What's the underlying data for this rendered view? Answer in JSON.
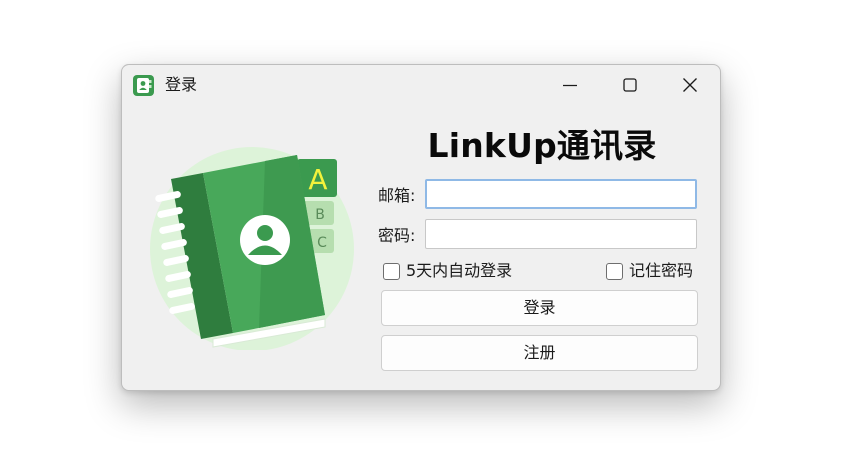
{
  "window": {
    "title": "登录",
    "icon": "app-contacts-icon",
    "controls": [
      "minimize-icon",
      "maximize-icon",
      "close-icon"
    ]
  },
  "illustration": {
    "icon": "address-book-icon",
    "tab_letters": [
      "A",
      "B",
      "C"
    ]
  },
  "form": {
    "heading": "LinkUp通讯录",
    "email_label": "邮箱:",
    "email_value": "",
    "password_label": "密码:",
    "password_value": "",
    "auto_login_label": "5天内自动登录",
    "auto_login_checked": false,
    "remember_label": "记住密码",
    "remember_checked": false,
    "login_button": "登录",
    "register_button": "注册"
  },
  "colors": {
    "accent_green": "#3b9a4f",
    "focus_border": "#8fb9e6",
    "tab_letter": "#f2f23c"
  }
}
